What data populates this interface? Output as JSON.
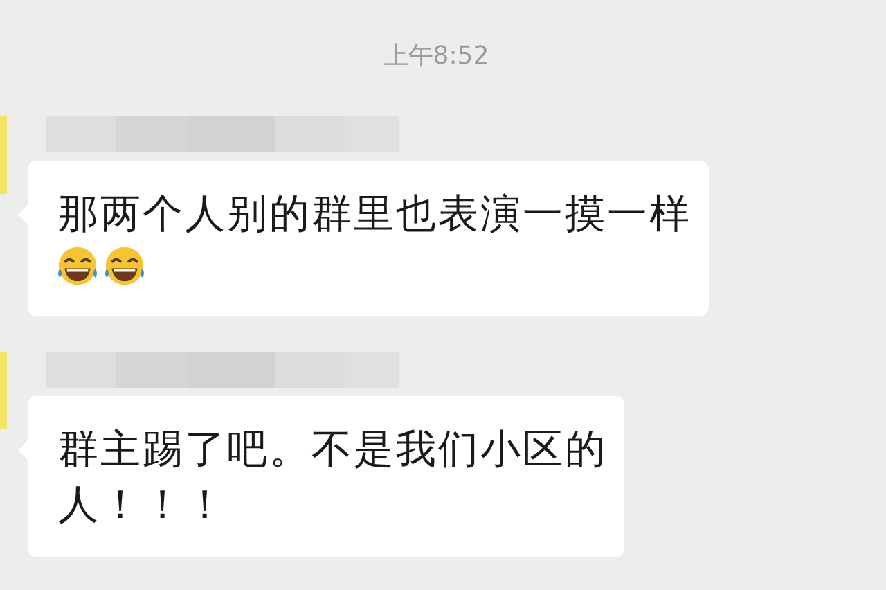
{
  "timestamp": "上午8:52",
  "messages": [
    {
      "lines": [
        "那两个人别的群里也表演一摸一样"
      ],
      "emojis": [
        {
          "kind": "tears-of-joy"
        },
        {
          "kind": "tears-of-joy"
        }
      ]
    },
    {
      "lines": [
        "群主踢了吧。不是我们小区的",
        "人！！！"
      ]
    }
  ]
}
